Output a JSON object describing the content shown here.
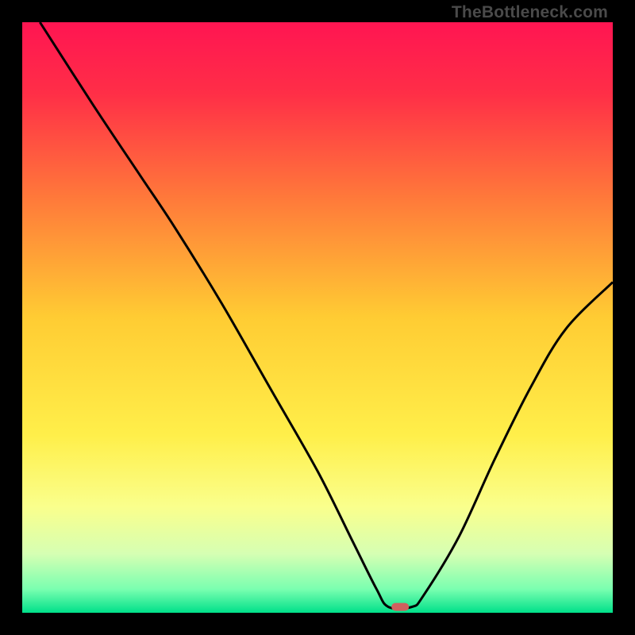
{
  "watermark": "TheBottleneck.com",
  "chart_data": {
    "type": "line",
    "title": "",
    "xlabel": "",
    "ylabel": "",
    "xlim": [
      0,
      100
    ],
    "ylim": [
      0,
      100
    ],
    "background_gradient": {
      "stops": [
        {
          "pct": 0,
          "color": "#ff1552"
        },
        {
          "pct": 12,
          "color": "#ff2e47"
        },
        {
          "pct": 30,
          "color": "#ff7a3a"
        },
        {
          "pct": 50,
          "color": "#ffcc33"
        },
        {
          "pct": 70,
          "color": "#ffef4a"
        },
        {
          "pct": 82,
          "color": "#faff8c"
        },
        {
          "pct": 90,
          "color": "#d6ffb3"
        },
        {
          "pct": 96,
          "color": "#7affb0"
        },
        {
          "pct": 100,
          "color": "#00e08a"
        }
      ]
    },
    "curve_points": [
      {
        "x": 3,
        "y": 100
      },
      {
        "x": 12,
        "y": 86
      },
      {
        "x": 20,
        "y": 74
      },
      {
        "x": 26,
        "y": 65
      },
      {
        "x": 34,
        "y": 52
      },
      {
        "x": 42,
        "y": 38
      },
      {
        "x": 50,
        "y": 24
      },
      {
        "x": 56,
        "y": 12
      },
      {
        "x": 60,
        "y": 4
      },
      {
        "x": 62,
        "y": 1
      },
      {
        "x": 66,
        "y": 1
      },
      {
        "x": 68,
        "y": 3
      },
      {
        "x": 74,
        "y": 13
      },
      {
        "x": 80,
        "y": 26
      },
      {
        "x": 86,
        "y": 38
      },
      {
        "x": 92,
        "y": 48
      },
      {
        "x": 100,
        "y": 56
      }
    ],
    "optimal_marker": {
      "x": 64,
      "y": 1,
      "color": "#d0605e"
    }
  }
}
